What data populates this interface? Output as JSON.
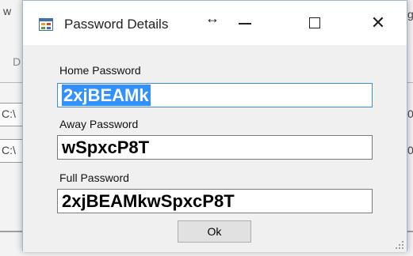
{
  "background": {
    "fragments": [
      "w",
      "D",
      "C:\\",
      "C:\\",
      "g",
      "0",
      "0"
    ]
  },
  "dialog": {
    "title": "Password Details",
    "icons": {
      "app": "app-form-icon",
      "resize": "resize-cursor-icon",
      "minimize": "minimize-icon",
      "maximize": "maximize-icon",
      "close": "close-icon"
    },
    "close_glyph": "✕",
    "resize_glyph": "↔",
    "home_label": "Home Password",
    "home_value": "2xjBEAMk",
    "away_label": "Away Password",
    "away_value": "wSpxcP8T",
    "full_label": "Full Password",
    "full_value": "2xjBEAMkwSpxcP8T",
    "ok_label": "Ok"
  },
  "colors": {
    "selection": "#3390ff",
    "focus_border": "#3c8fdc",
    "dialog_bg": "#f0f0f0"
  }
}
